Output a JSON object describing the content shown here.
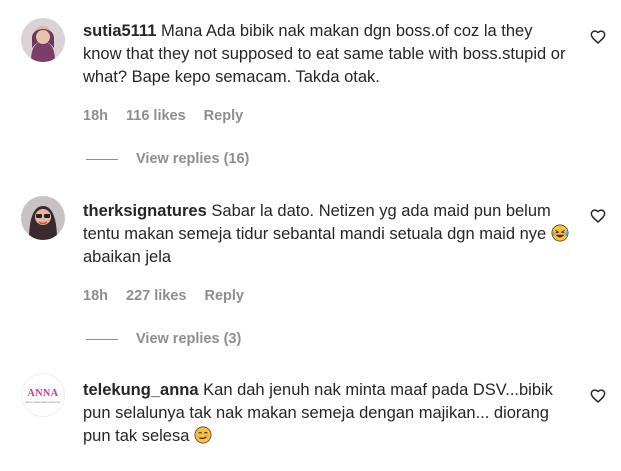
{
  "comments": [
    {
      "username": "sutia5111",
      "text": "Mana Ada bibik nak makan dgn boss.of coz la they know that they not supposed to eat same table with boss.stupid or what? Bape kepo semacam. Takda otak.",
      "time": "18h",
      "likes": "116 likes",
      "reply": "Reply",
      "view_replies": "View replies (16)"
    },
    {
      "username": "therksignatures",
      "text": "Sabar la dato. Netizen yg ada maid pun belum tentu makan semeja tidur sebantal mandi setuala dgn maid nye",
      "text_after_emoji": "abaikan jela",
      "emoji": "rolling-on-floor-laughing-emoji",
      "time": "18h",
      "likes": "227 likes",
      "reply": "Reply",
      "view_replies": "View replies (3)"
    },
    {
      "username": "telekung_anna",
      "text": "Kan dah jenuh nak minta maaf pada DSV...bibik pun selalunya tak nak makan semeja dengan majikan... diorang pun tak selesa",
      "emoji": "smirking-face-emoji",
      "avatar_logo": "ANNA",
      "avatar_logo_sub": "Best Handmade Telekung"
    }
  ],
  "icons": {
    "like": "heart-outline-icon"
  },
  "colors": {
    "text": "#262626",
    "secondary": "#8e8e8e",
    "logo_pink": "#d63384"
  }
}
